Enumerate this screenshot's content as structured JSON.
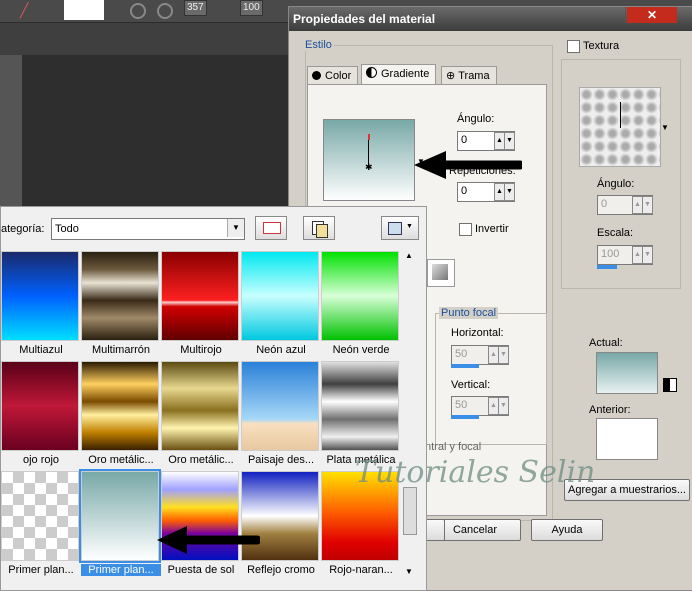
{
  "app": {
    "toolbar_value_1": "357",
    "toolbar_value_2": "100"
  },
  "dialog": {
    "title": "Propiedades del material",
    "close_glyph": "✕",
    "estilo_label": "Estilo",
    "tabs": [
      {
        "label": "Color"
      },
      {
        "label": "Gradiente"
      },
      {
        "label": "Trama"
      }
    ],
    "angulo_label": "Ángulo:",
    "angulo_value": "0",
    "repeticiones_label": "Repeticiones:",
    "repeticiones_value": "0",
    "invertir_label": "Invertir",
    "punto_focal_label": "Punto focal",
    "horizontal_label": "Horizontal:",
    "horizontal_value": "50",
    "vertical_label": "Vertical:",
    "vertical_value": "50",
    "central_focal_label": "ntral y focal",
    "textura_label": "Textura",
    "tex_angulo_label": "Ángulo:",
    "tex_angulo_value": "0",
    "escala_label": "Escala:",
    "escala_value": "100",
    "actual_label": "Actual:",
    "anterior_label": "Anterior:",
    "add_button": "Agregar a muestrarios...",
    "cancel_button": "Cancelar",
    "help_button": "Ayuda",
    "watermark": "Tutoriales Selin"
  },
  "picker": {
    "category_label": "ategoría:",
    "category_value": "Todo",
    "swatches": [
      {
        "label": "Multiazul"
      },
      {
        "label": "Multimarrón"
      },
      {
        "label": "Multirojo"
      },
      {
        "label": "Neón azul"
      },
      {
        "label": "Neón verde"
      },
      {
        "label": "ojo rojo"
      },
      {
        "label": "Oro metálic..."
      },
      {
        "label": "Oro metálic..."
      },
      {
        "label": "Paisaje des..."
      },
      {
        "label": "Plata metálica"
      },
      {
        "label": "Primer plan..."
      },
      {
        "label": "Primer plan..."
      },
      {
        "label": "Puesta de sol"
      },
      {
        "label": "Reflejo cromo"
      },
      {
        "label": "Rojo-naran..."
      }
    ]
  },
  "colors": {
    "accent": "#3a8ee6",
    "legend_blue": "#1b4f9c",
    "close_red": "#c42b1c"
  }
}
